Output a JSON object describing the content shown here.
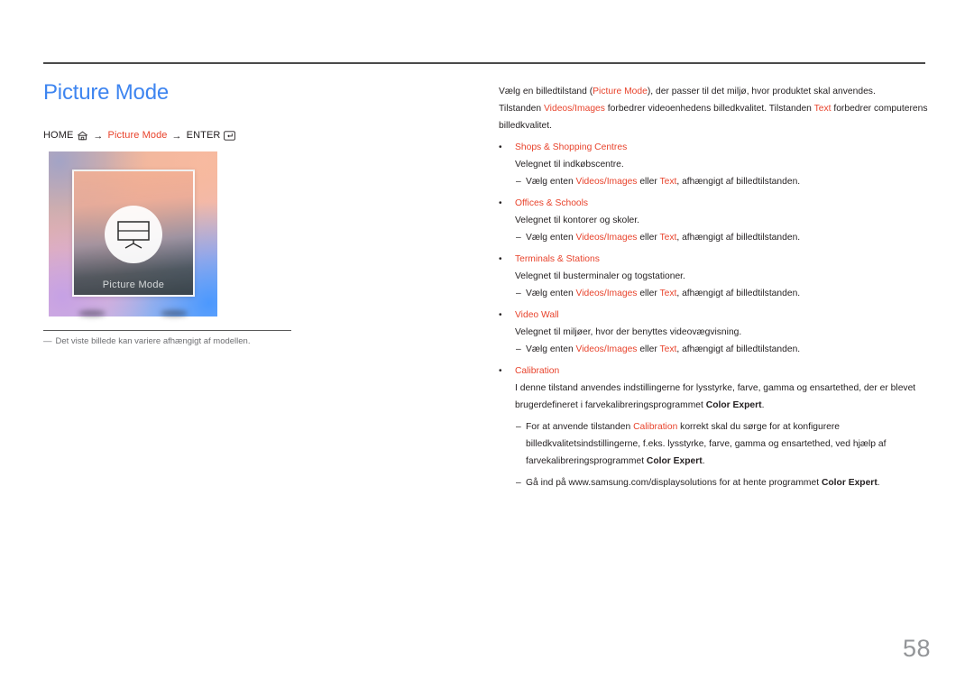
{
  "page": {
    "title": "Picture Mode",
    "number": "58"
  },
  "breadcrumb": {
    "home_label": "HOME",
    "home_icon": "house-icon",
    "arrow1": "→",
    "target_label": "Picture Mode",
    "arrow2": "→",
    "enter_label": "ENTER",
    "enter_icon": "enter-key-icon"
  },
  "thumbnail": {
    "caption": "Picture Mode",
    "icon": "monitor-icon"
  },
  "footnote": {
    "dash": "―",
    "text": "Det viste billede kan variere afhængigt af modellen."
  },
  "intro": {
    "line1_a": "Vælg en billedtilstand (",
    "line1_accent": "Picture Mode",
    "line1_b": "), der passer til det miljø, hvor produktet skal anvendes.",
    "line2_a": "Tilstanden ",
    "line2_accent1": "Videos/Images",
    "line2_b": " forbedrer videoenhedens billedkvalitet. Tilstanden ",
    "line2_accent2": "Text",
    "line2_c": " forbedrer computerens billedkvalitet."
  },
  "common": {
    "bullet": "•",
    "dash": "–",
    "choose_a": "Vælg enten ",
    "choose_accent1": "Videos/Images",
    "choose_b": " eller ",
    "choose_accent2": "Text",
    "choose_c": ", afhængigt af billedtilstanden."
  },
  "modes": [
    {
      "title": "Shops & Shopping Centres",
      "description": "Velegnet til indkøbscentre."
    },
    {
      "title": "Offices & Schools",
      "description": "Velegnet til kontorer og skoler."
    },
    {
      "title": "Terminals & Stations",
      "description": "Velegnet til busterminaler og togstationer."
    },
    {
      "title": "Video Wall",
      "description": "Velegnet til miljøer, hvor der benyttes videovægvisning."
    }
  ],
  "calibration": {
    "title": "Calibration",
    "desc_a": "I denne tilstand anvendes indstillingerne for lysstyrke, farve, gamma og ensartethed, der er blevet brugerdefineret i farvekalibreringsprogrammet ",
    "desc_bold": "Color Expert",
    "desc_b": ".",
    "sub1_a": "For at anvende tilstanden ",
    "sub1_accent": "Calibration",
    "sub1_b": " korrekt skal du sørge for at konfigurere billedkvalitetsindstillingerne, f.eks. lysstyrke, farve, gamma og ensartethed, ved hjælp af farvekalibreringsprogrammet ",
    "sub1_bold": "Color Expert",
    "sub1_c": ".",
    "sub2_a": "Gå ind på www.samsung.com/displaysolutions for at hente programmet ",
    "sub2_bold": "Color Expert",
    "sub2_b": "."
  },
  "colors": {
    "title_blue": "#3e85f0",
    "accent_orange": "#e8432c",
    "body_text": "#231f20",
    "page_number_gray": "#939598"
  }
}
